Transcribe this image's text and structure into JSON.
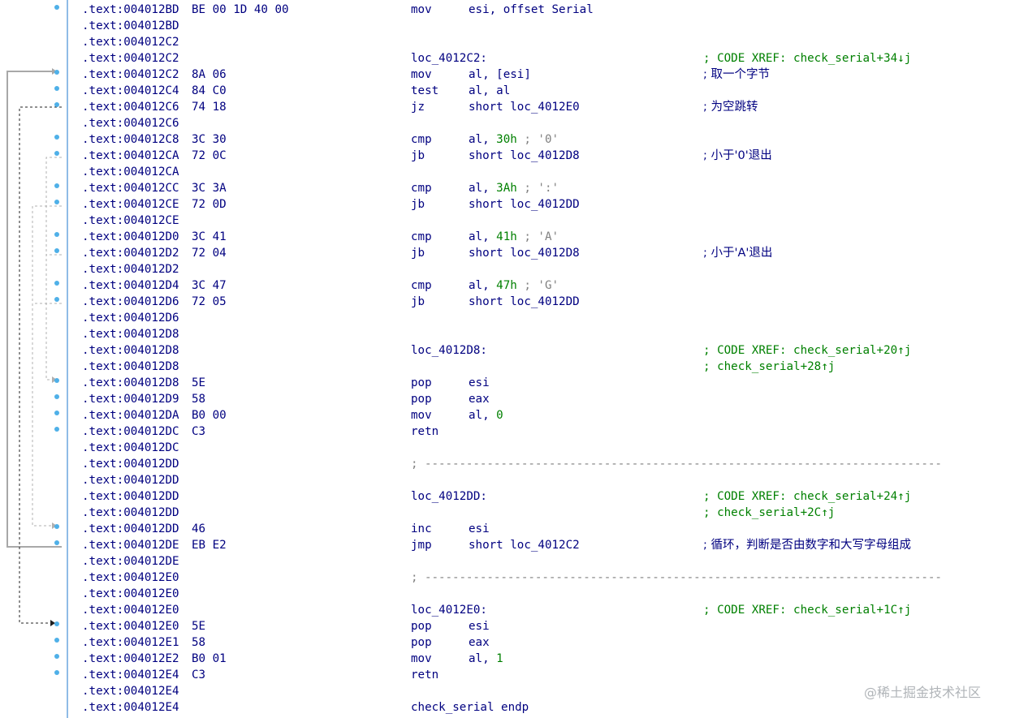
{
  "lines": [
    {
      "addr": ".text:004012BD",
      "bytes": "BE 00 1D 40 00",
      "mnemonic": "mov",
      "operand": "esi, offset Serial",
      "dot": true
    },
    {
      "addr": ".text:004012BD"
    },
    {
      "addr": ".text:004012C2"
    },
    {
      "addr": ".text:004012C2",
      "label": "loc_4012C2:",
      "comment": "; CODE XREF: check_serial+34↓j"
    },
    {
      "addr": ".text:004012C2",
      "bytes": "8A 06",
      "mnemonic": "mov",
      "operand": "al, [esi]",
      "comment": "; 取一个字节",
      "comment_cn": true,
      "dot": true
    },
    {
      "addr": ".text:004012C4",
      "bytes": "84 C0",
      "mnemonic": "test",
      "operand": "al, al",
      "dot": true
    },
    {
      "addr": ".text:004012C6",
      "bytes": "74 18",
      "mnemonic": "jz",
      "operand": "short loc_4012E0",
      "comment": "; 为空跳转",
      "comment_cn": true,
      "dot": true
    },
    {
      "addr": ".text:004012C6"
    },
    {
      "addr": ".text:004012C8",
      "bytes": "3C 30",
      "mnemonic": "cmp",
      "operand": "al, ",
      "num": "30h",
      "opcomment": " ; '0'",
      "dot": true
    },
    {
      "addr": ".text:004012CA",
      "bytes": "72 0C",
      "mnemonic": "jb",
      "operand": "short loc_4012D8",
      "comment": "; 小于'0'退出",
      "comment_cn": true,
      "dot": true
    },
    {
      "addr": ".text:004012CA"
    },
    {
      "addr": ".text:004012CC",
      "bytes": "3C 3A",
      "mnemonic": "cmp",
      "operand": "al, ",
      "num": "3Ah",
      "opcomment": " ; ':'",
      "dot": true
    },
    {
      "addr": ".text:004012CE",
      "bytes": "72 0D",
      "mnemonic": "jb",
      "operand": "short loc_4012DD",
      "dot": true
    },
    {
      "addr": ".text:004012CE"
    },
    {
      "addr": ".text:004012D0",
      "bytes": "3C 41",
      "mnemonic": "cmp",
      "operand": "al, ",
      "num": "41h",
      "opcomment": " ; 'A'",
      "dot": true
    },
    {
      "addr": ".text:004012D2",
      "bytes": "72 04",
      "mnemonic": "jb",
      "operand": "short loc_4012D8",
      "comment": "; 小于'A'退出",
      "comment_cn": true,
      "dot": true
    },
    {
      "addr": ".text:004012D2"
    },
    {
      "addr": ".text:004012D4",
      "bytes": "3C 47",
      "mnemonic": "cmp",
      "operand": "al, ",
      "num": "47h",
      "opcomment": " ; 'G'",
      "dot": true
    },
    {
      "addr": ".text:004012D6",
      "bytes": "72 05",
      "mnemonic": "jb",
      "operand": "short loc_4012DD",
      "dot": true
    },
    {
      "addr": ".text:004012D6"
    },
    {
      "addr": ".text:004012D8"
    },
    {
      "addr": ".text:004012D8",
      "label": "loc_4012D8:",
      "comment": "; CODE XREF: check_serial+20↑j"
    },
    {
      "addr": ".text:004012D8",
      "comment": "; check_serial+28↑j"
    },
    {
      "addr": ".text:004012D8",
      "bytes": "5E",
      "mnemonic": "pop",
      "operand": "esi",
      "dot": true
    },
    {
      "addr": ".text:004012D9",
      "bytes": "58",
      "mnemonic": "pop",
      "operand": "eax",
      "dot": true
    },
    {
      "addr": ".text:004012DA",
      "bytes": "B0 00",
      "mnemonic": "mov",
      "operand": "al, ",
      "num": "0",
      "dot": true
    },
    {
      "addr": ".text:004012DC",
      "bytes": "C3",
      "mnemonic": "retn",
      "dot": true
    },
    {
      "addr": ".text:004012DC"
    },
    {
      "addr": ".text:004012DD",
      "separator": "; ---------------------------------------------------------------------------"
    },
    {
      "addr": ".text:004012DD"
    },
    {
      "addr": ".text:004012DD",
      "label": "loc_4012DD:",
      "comment": "; CODE XREF: check_serial+24↑j"
    },
    {
      "addr": ".text:004012DD",
      "comment": "; check_serial+2C↑j"
    },
    {
      "addr": ".text:004012DD",
      "bytes": "46",
      "mnemonic": "inc",
      "operand": "esi",
      "dot": true
    },
    {
      "addr": ".text:004012DE",
      "bytes": "EB E2",
      "mnemonic": "jmp",
      "operand": "short loc_4012C2",
      "comment": "; 循环，判断是否由数字和大写字母组成",
      "comment_cn": true,
      "dot": true
    },
    {
      "addr": ".text:004012DE"
    },
    {
      "addr": ".text:004012E0",
      "separator": "; ---------------------------------------------------------------------------"
    },
    {
      "addr": ".text:004012E0"
    },
    {
      "addr": ".text:004012E0",
      "label": "loc_4012E0:",
      "comment": "; CODE XREF: check_serial+1C↑j"
    },
    {
      "addr": ".text:004012E0",
      "bytes": "5E",
      "mnemonic": "pop",
      "operand": "esi",
      "dot": true
    },
    {
      "addr": ".text:004012E1",
      "bytes": "58",
      "mnemonic": "pop",
      "operand": "eax",
      "dot": true
    },
    {
      "addr": ".text:004012E2",
      "bytes": "B0 01",
      "mnemonic": "mov",
      "operand": "al, ",
      "num": "1",
      "dot": true
    },
    {
      "addr": ".text:004012E4",
      "bytes": "C3",
      "mnemonic": "retn",
      "dot": true
    },
    {
      "addr": ".text:004012E4"
    },
    {
      "addr": ".text:004012E4",
      "label": "check_serial endp"
    }
  ],
  "watermark": "@稀土掘金技术社区",
  "colors": {
    "address": "#000080",
    "number": "#008000",
    "comment": "#008000",
    "gutter_dot": "#4fb0e8",
    "gutter_border": "#8fbce6"
  }
}
